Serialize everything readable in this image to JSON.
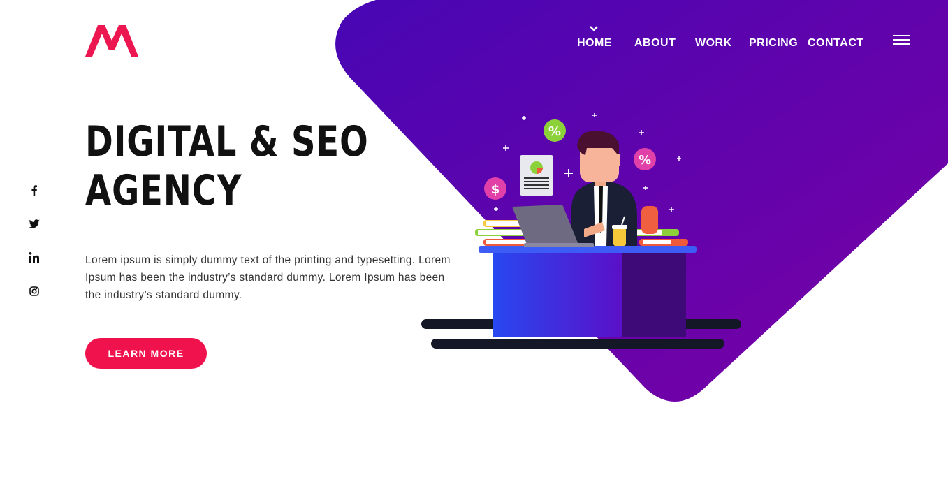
{
  "brand": {
    "logo_text": "M",
    "logo_color": "#ec1650"
  },
  "nav": {
    "items": [
      {
        "label": "HOME",
        "active": true
      },
      {
        "label": "ABOUT",
        "active": false
      },
      {
        "label": "WORK",
        "active": false
      },
      {
        "label": "PRICING",
        "active": false
      },
      {
        "label": "CONTACT",
        "active": false
      }
    ],
    "menu_icon": "hamburger-icon"
  },
  "socials": [
    "facebook-icon",
    "twitter-icon",
    "linkedin-icon",
    "instagram-icon"
  ],
  "hero": {
    "title_line1": "DIGITAL & SEO",
    "title_line2": "AGENCY",
    "lead": "Lorem ipsum is simply dummy text of the printing and typesetting. Lorem Ipsum has been the industry’s standard dummy. Lorem Ipsum has been the industry’s standard dummy.",
    "cta_label": "LEARN MORE"
  },
  "illustration": {
    "badge_percent_1": "%",
    "badge_percent_2": "%",
    "badge_dollar": "$"
  },
  "colors": {
    "accent": "#f0124d",
    "hero_gradient_start": "#4a06b3",
    "hero_gradient_end": "#7200a8",
    "desk_blue": "#2c4ef2",
    "desk_purple": "#3e0a78",
    "text_dark": "#111111"
  }
}
